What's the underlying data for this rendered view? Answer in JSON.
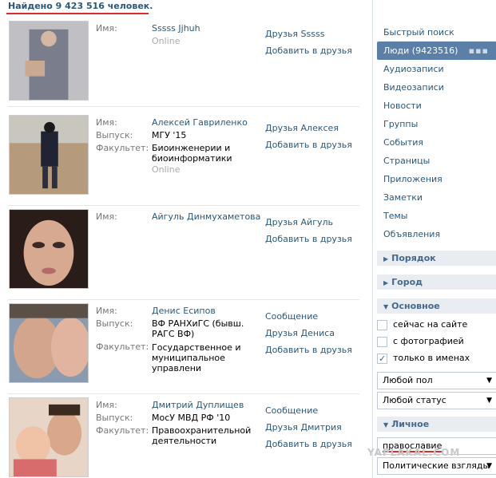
{
  "header": {
    "found": "Найдено 9 423 516 человек."
  },
  "results": [
    {
      "labels": [
        "Имя:"
      ],
      "name": "Sssss Jjhuh",
      "extra": [],
      "online": "Online",
      "actions": [
        "Друзья Sssss",
        "Добавить в друзья"
      ]
    },
    {
      "labels": [
        "Имя:",
        "Выпуск:",
        "Факультет:"
      ],
      "name": "Алексей Гавриленко",
      "extra": [
        "МГУ '15",
        "Биоинженерии и биоинформатики"
      ],
      "online": "Online",
      "actions": [
        "Друзья Алексея",
        "Добавить в друзья"
      ]
    },
    {
      "labels": [
        "Имя:"
      ],
      "name": "Айгуль Динмухаметова",
      "extra": [],
      "online": "",
      "actions": [
        "Друзья Айгуль",
        "Добавить в друзья"
      ]
    },
    {
      "labels": [
        "Имя:",
        "Выпуск:",
        "Факультет:"
      ],
      "name": "Денис Есипов",
      "extra": [
        "ВФ РАНХиГС (бывш. РАГС ВФ)",
        "Государственное и муниципальное управлени"
      ],
      "online": "",
      "actions": [
        "Сообщение",
        "Друзья Дениса",
        "Добавить в друзья"
      ]
    },
    {
      "labels": [
        "Имя:",
        "Выпуск:",
        "Факультет:"
      ],
      "name": "Дмитрий Дуплищев",
      "extra": [
        "МосУ МВД РФ '10",
        "Правоохранительной деятельности"
      ],
      "online": "",
      "actions": [
        "Сообщение",
        "Друзья Дмитрия",
        "Добавить в друзья"
      ]
    }
  ],
  "sidebar": {
    "nav": [
      "Быстрый поиск",
      "Люди (9423516)",
      "Аудиозаписи",
      "Видеозаписи",
      "Новости",
      "Группы",
      "События",
      "Страницы",
      "Приложения",
      "Заметки",
      "Темы",
      "Объявления"
    ],
    "nav_active_index": 1,
    "sections": {
      "order": "Порядок",
      "city": "Город",
      "basic": "Основное",
      "personal": "Личное"
    },
    "checkboxes": [
      {
        "label": "сейчас на сайте",
        "checked": false
      },
      {
        "label": "с фотографией",
        "checked": false
      },
      {
        "label": "только в именах",
        "checked": true
      }
    ],
    "gender_select": "Любой пол",
    "status_select": "Любой статус",
    "personal_input": "православие",
    "political_select": "Политические взгляды"
  },
  "watermark": "YAPLAKAL.COM",
  "colors": {
    "link": "#2b587a",
    "active": "#5b7fa6",
    "highlight": "#d32f2f"
  }
}
